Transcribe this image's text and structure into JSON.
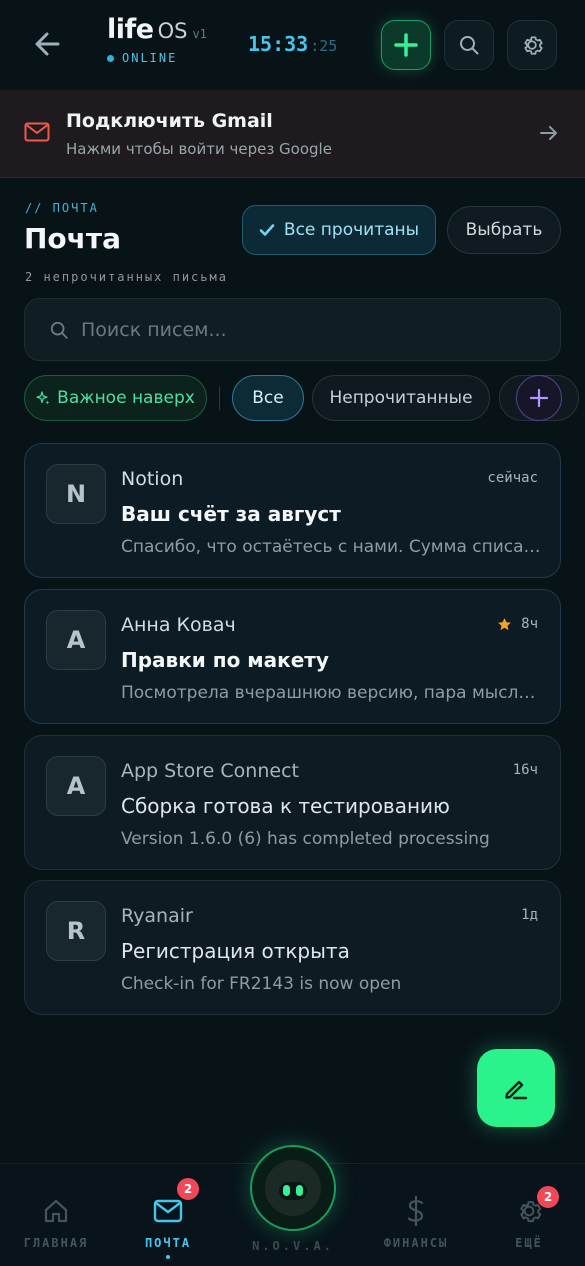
{
  "header": {
    "brand_life": "life",
    "brand_os": "OS",
    "brand_version": "v1",
    "status": "ONLINE",
    "clock_hm": "15:33",
    "clock_sec": ":25",
    "accent": "#47c6ec",
    "icons": [
      "back-arrow-icon",
      "plus-icon",
      "search-icon",
      "gear-icon"
    ]
  },
  "banner": {
    "title": "Подключить Gmail",
    "subtitle": "Нажми чтобы войти через Google"
  },
  "section": {
    "kicker": "// ПОЧТА",
    "title": "Почта",
    "subtitle": "2 непрочитанных письма",
    "mark_all_read": "Все прочитаны",
    "select": "Выбрать"
  },
  "search": {
    "placeholder": "Поиск писем..."
  },
  "filters": {
    "important_first": "Важное наверх",
    "all": "Все",
    "unread": "Непрочитанные",
    "active": "Все"
  },
  "emails": [
    {
      "initial": "N",
      "sender": "Notion",
      "time": "сейчас",
      "subject": "Ваш счёт за август",
      "preview": "Спасибо, что остаётесь с нами. Сумма списания...",
      "unread": true,
      "starred": false
    },
    {
      "initial": "A",
      "sender": "Анна Ковач",
      "time": "8ч",
      "subject": "Правки по макету",
      "preview": "Посмотрела вчерашнюю версию, пара мыслей по...",
      "unread": true,
      "starred": true
    },
    {
      "initial": "A",
      "sender": "App Store Connect",
      "time": "16ч",
      "subject": "Сборка готова к тестированию",
      "preview": "Version 1.6.0 (6) has completed processing",
      "unread": false,
      "starred": false
    },
    {
      "initial": "R",
      "sender": "Ryanair",
      "time": "1д",
      "subject": "Регистрация открыта",
      "preview": "Check-in for FR2143 is now open",
      "unread": false,
      "starred": false
    }
  ],
  "nav": {
    "home": "ГЛАВНАЯ",
    "mail": "ПОЧТА",
    "mail_badge": "2",
    "nova": "N.O.V.A.",
    "finance": "ФИНАНСЫ",
    "more": "ЕЩЁ",
    "more_badge": "2",
    "active": "ПОЧТА"
  }
}
